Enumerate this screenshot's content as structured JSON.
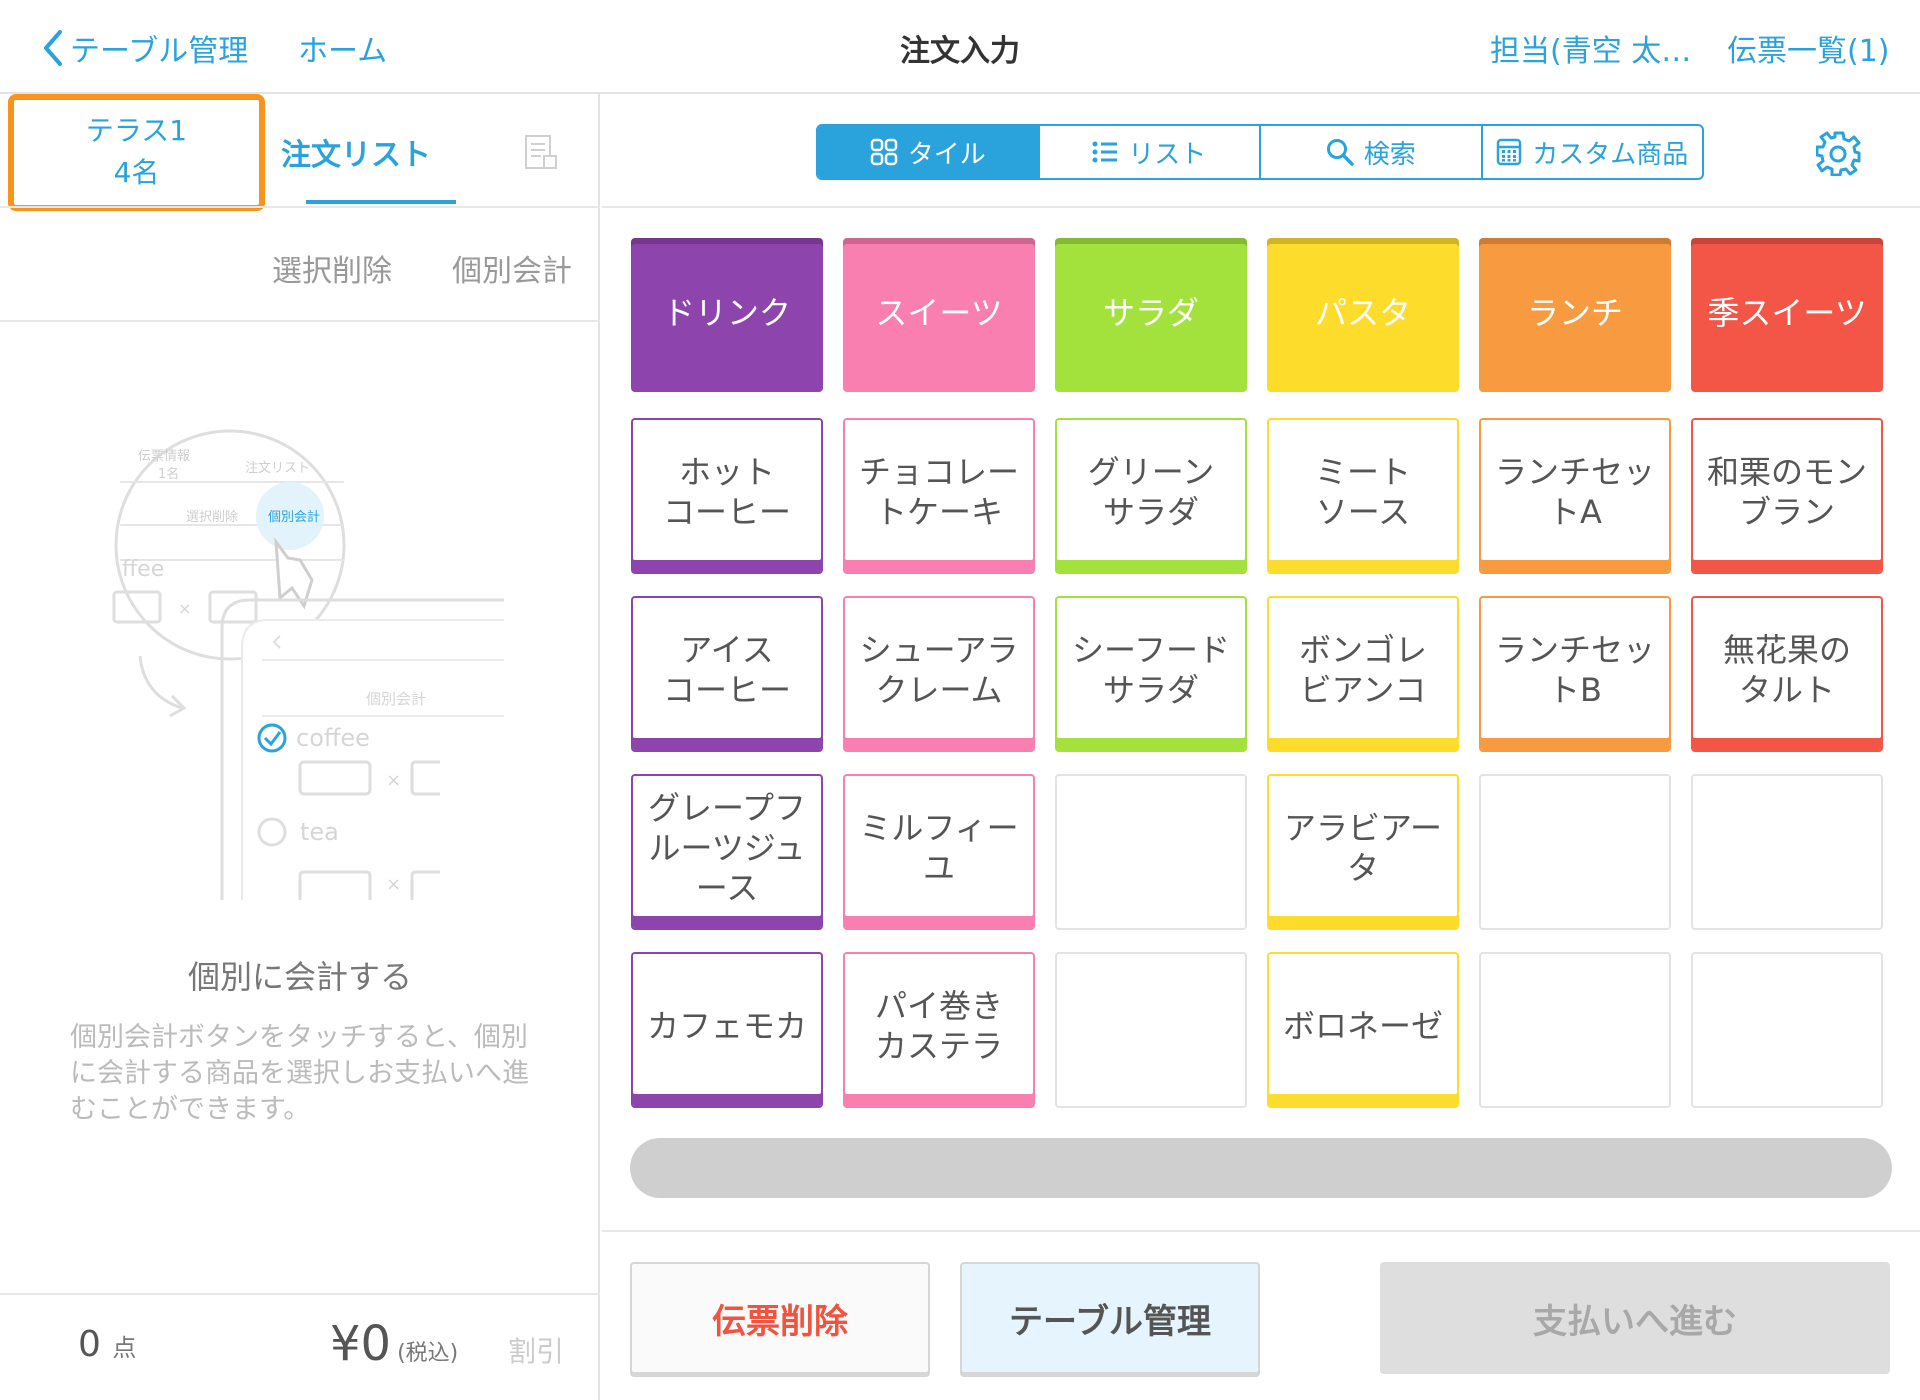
{
  "header": {
    "back_label": "テーブル管理",
    "home_label": "ホーム",
    "title": "注文入力",
    "staff_label": "担当(青空 太…",
    "slips_label": "伝票一覧(1)"
  },
  "left": {
    "table_name": "テラス1",
    "party_size": "4名",
    "order_tab": "注文リスト",
    "delete_selected": "選択削除",
    "split_bill": "個別会計",
    "guide_title": "個別に会計する",
    "guide_body": "個別会計ボタンをタッチすると、個別に会計する商品を選択しお支払いへ進むことができます。",
    "illustration": {
      "slip_info": "伝票情報",
      "slip_count": "1名",
      "order_list": "注文リスト",
      "delete_selected": "選択削除",
      "split_bill": "個別会計",
      "item_partial": "ffee",
      "split_bill_2": "個別会計",
      "item1": "coffee",
      "item2": "tea"
    },
    "footer": {
      "count": "0",
      "count_unit": "点",
      "total": "¥0",
      "tax_label": "(税込)",
      "discount": "割引"
    }
  },
  "view_modes": [
    {
      "label": "タイル",
      "icon": "tile-icon",
      "selected": true
    },
    {
      "label": "リスト",
      "icon": "list-icon",
      "selected": false
    },
    {
      "label": "検索",
      "icon": "search-icon",
      "selected": false
    },
    {
      "label": "カスタム商品",
      "icon": "calculator-icon",
      "selected": false
    }
  ],
  "categories": [
    {
      "label": "ドリンク",
      "color": "#8e44ad"
    },
    {
      "label": "スイーツ",
      "color": "#f97fb0"
    },
    {
      "label": "サラダ",
      "color": "#a3e23c"
    },
    {
      "label": "パスタ",
      "color": "#fddc2b"
    },
    {
      "label": "ランチ",
      "color": "#f89a3f"
    },
    {
      "label": "季スイーツ",
      "color": "#f35646"
    }
  ],
  "products": [
    [
      "ホット\nコーヒー",
      "チョコレー\nトケーキ",
      "グリーン\nサラダ",
      "ミート\nソース",
      "ランチセッ\nトA",
      "和栗のモン\nブラン"
    ],
    [
      "アイス\nコーヒー",
      "シューアラ\nクレーム",
      "シーフード\nサラダ",
      "ボンゴレ\nビアンコ",
      "ランチセッ\nトB",
      "無花果の\nタルト"
    ],
    [
      "グレープフ\nルーツジュ\nース",
      "ミルフィー\nユ",
      "",
      "アラビアー\nタ",
      "",
      ""
    ],
    [
      "カフェモカ",
      "パイ巻き\nカステラ",
      "",
      "ボロネーゼ",
      "",
      ""
    ]
  ],
  "buttons": {
    "delete_slip": "伝票削除",
    "table_manage": "テーブル管理",
    "proceed_payment": "支払いへ進む"
  },
  "colors": {
    "accent": "#2aa3dc",
    "highlight_border": "#f7941d",
    "danger_text": "#f0533e"
  }
}
